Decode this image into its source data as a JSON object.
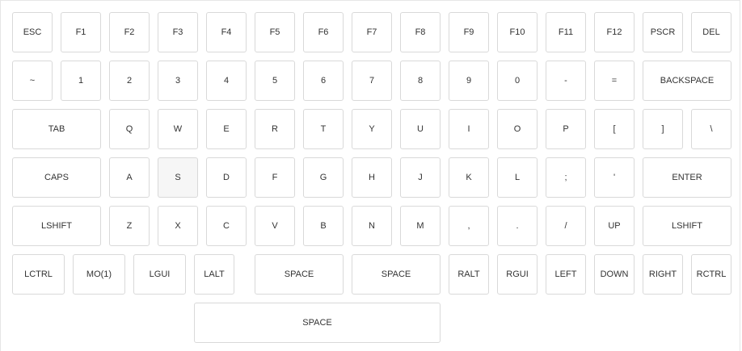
{
  "keyboard": {
    "rows": [
      [
        {
          "label": "ESC"
        },
        {
          "label": "F1"
        },
        {
          "label": "F2"
        },
        {
          "label": "F3"
        },
        {
          "label": "F4"
        },
        {
          "label": "F5"
        },
        {
          "label": "F6"
        },
        {
          "label": "F7"
        },
        {
          "label": "F8"
        },
        {
          "label": "F9"
        },
        {
          "label": "F10"
        },
        {
          "label": "F11"
        },
        {
          "label": "F12"
        },
        {
          "label": "PSCR"
        },
        {
          "label": "DEL"
        }
      ],
      [
        {
          "label": "~"
        },
        {
          "label": "1"
        },
        {
          "label": "2"
        },
        {
          "label": "3"
        },
        {
          "label": "4"
        },
        {
          "label": "5"
        },
        {
          "label": "6"
        },
        {
          "label": "7"
        },
        {
          "label": "8"
        },
        {
          "label": "9"
        },
        {
          "label": "0"
        },
        {
          "label": "-"
        },
        {
          "label": "="
        },
        {
          "label": "BACKSPACE"
        }
      ],
      [
        {
          "label": "TAB"
        },
        {
          "label": "Q"
        },
        {
          "label": "W"
        },
        {
          "label": "E"
        },
        {
          "label": "R"
        },
        {
          "label": "T"
        },
        {
          "label": "Y"
        },
        {
          "label": "U"
        },
        {
          "label": "I"
        },
        {
          "label": "O"
        },
        {
          "label": "P"
        },
        {
          "label": "["
        },
        {
          "label": "]"
        },
        {
          "label": "\\"
        }
      ],
      [
        {
          "label": "CAPS"
        },
        {
          "label": "A"
        },
        {
          "label": "S",
          "pressed": true
        },
        {
          "label": "D"
        },
        {
          "label": "F"
        },
        {
          "label": "G"
        },
        {
          "label": "H"
        },
        {
          "label": "J"
        },
        {
          "label": "K"
        },
        {
          "label": "L"
        },
        {
          "label": ";"
        },
        {
          "label": "'"
        },
        {
          "label": "ENTER"
        }
      ],
      [
        {
          "label": "LSHIFT"
        },
        {
          "label": "Z"
        },
        {
          "label": "X"
        },
        {
          "label": "C"
        },
        {
          "label": "V"
        },
        {
          "label": "B"
        },
        {
          "label": "N"
        },
        {
          "label": "M"
        },
        {
          "label": ","
        },
        {
          "label": "."
        },
        {
          "label": "/"
        },
        {
          "label": "UP"
        },
        {
          "label": "LSHIFT"
        }
      ],
      [
        {
          "label": "LCTRL"
        },
        {
          "label": "MO(1)"
        },
        {
          "label": "LGUI"
        },
        {
          "label": "LALT"
        },
        {
          "label": "SPACE"
        },
        {
          "label": "SPACE"
        },
        {
          "label": "RALT"
        },
        {
          "label": "RGUI"
        },
        {
          "label": "LEFT"
        },
        {
          "label": "DOWN"
        },
        {
          "label": "RIGHT"
        },
        {
          "label": "RCTRL"
        }
      ],
      [
        {
          "label": "SPACE"
        }
      ]
    ]
  }
}
